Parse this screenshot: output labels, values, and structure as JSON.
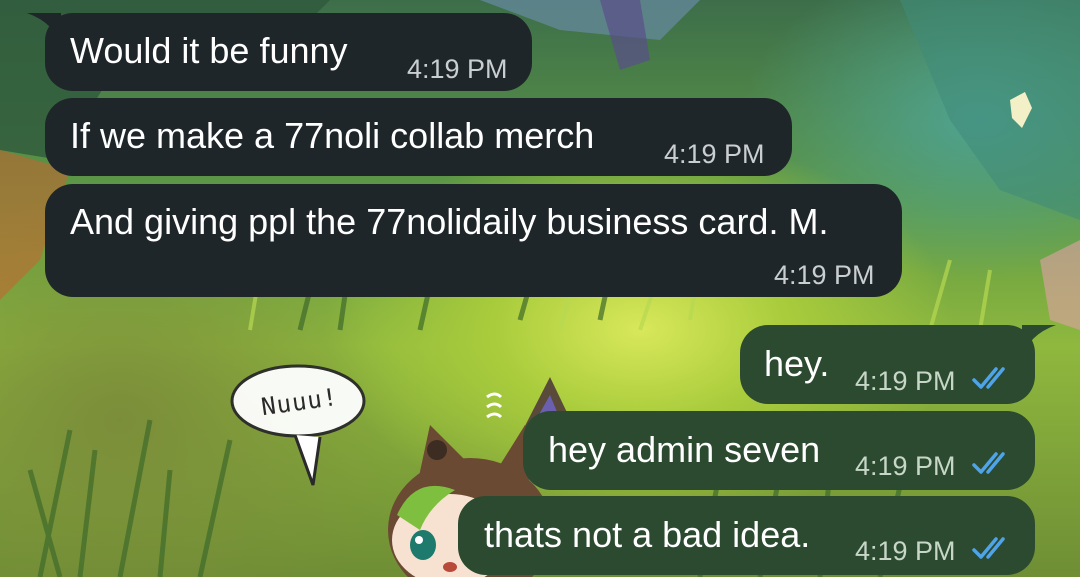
{
  "messages": [
    {
      "direction": "incoming",
      "text": "Would it be funny",
      "time": "4:19 PM"
    },
    {
      "direction": "incoming",
      "text": "If we make a 77noli collab merch",
      "time": "4:19 PM"
    },
    {
      "direction": "incoming",
      "text": "And giving ppl the 77nolidaily business card. M.",
      "time": "4:19 PM"
    },
    {
      "direction": "outgoing",
      "text": "hey.",
      "time": "4:19 PM",
      "status": "read"
    },
    {
      "direction": "outgoing",
      "text": "hey admin seven",
      "time": "4:19 PM",
      "status": "read"
    },
    {
      "direction": "outgoing",
      "text": "thats not a bad idea.",
      "time": "4:19 PM",
      "status": "read"
    }
  ],
  "sticker": {
    "speech_text": "Nuuu!",
    "icon": "chibi-cat-ear-character-sticker"
  },
  "colors": {
    "incoming_bubble": "#1f262a",
    "outgoing_bubble": "#2b4a30",
    "read_ticks": "#4fa3e8"
  },
  "icons": {
    "read_status": "double-check-icon"
  }
}
